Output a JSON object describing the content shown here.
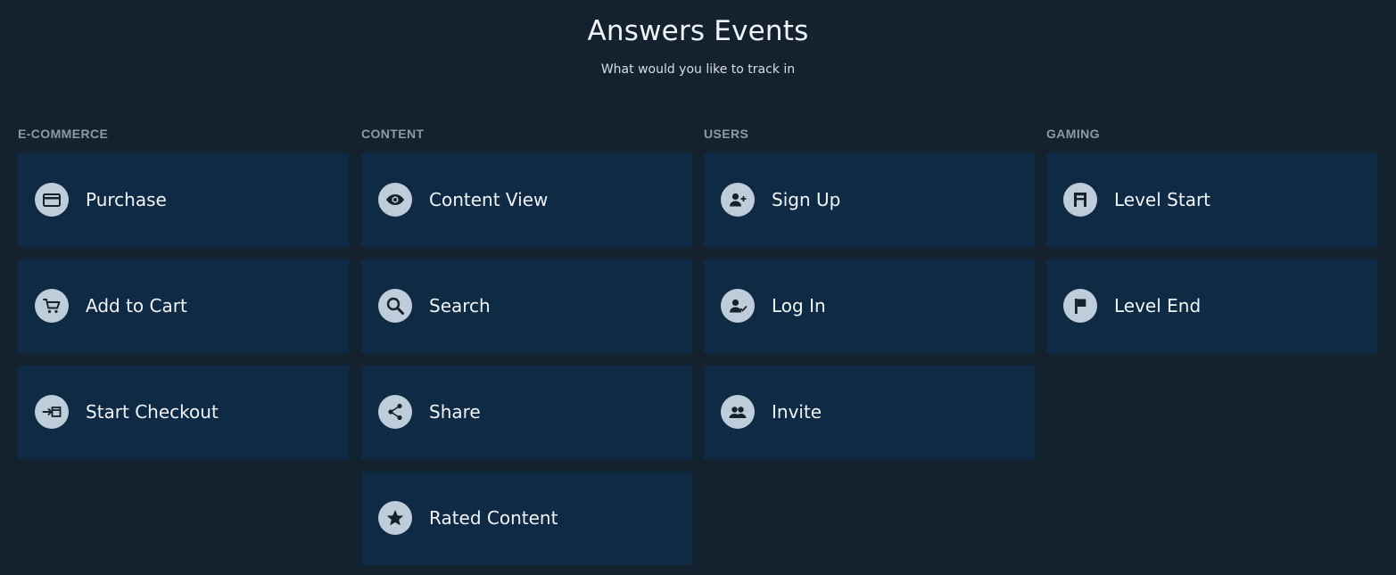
{
  "header": {
    "title": "Answers Events",
    "subtitle": "What would you like to track in"
  },
  "columns": [
    {
      "heading": "E-COMMERCE",
      "items": [
        {
          "label": "Purchase",
          "icon": "credit-card-icon"
        },
        {
          "label": "Add to Cart",
          "icon": "cart-icon"
        },
        {
          "label": "Start Checkout",
          "icon": "checkout-icon"
        }
      ]
    },
    {
      "heading": "CONTENT",
      "items": [
        {
          "label": "Content View",
          "icon": "eye-icon"
        },
        {
          "label": "Search",
          "icon": "search-icon"
        },
        {
          "label": "Share",
          "icon": "share-icon"
        },
        {
          "label": "Rated Content",
          "icon": "star-icon"
        }
      ]
    },
    {
      "heading": "USERS",
      "items": [
        {
          "label": "Sign Up",
          "icon": "user-plus-icon"
        },
        {
          "label": "Log In",
          "icon": "user-check-icon"
        },
        {
          "label": "Invite",
          "icon": "users-icon"
        }
      ]
    },
    {
      "heading": "GAMING",
      "items": [
        {
          "label": "Level Start",
          "icon": "level-start-icon"
        },
        {
          "label": "Level End",
          "icon": "flag-icon"
        }
      ]
    }
  ],
  "colors": {
    "background": "#14212f",
    "card": "#0f2a45",
    "icon_circle": "#bfccd9",
    "icon_glyph": "#14212f",
    "heading": "#8d99a6",
    "text": "#f1f4f7"
  }
}
